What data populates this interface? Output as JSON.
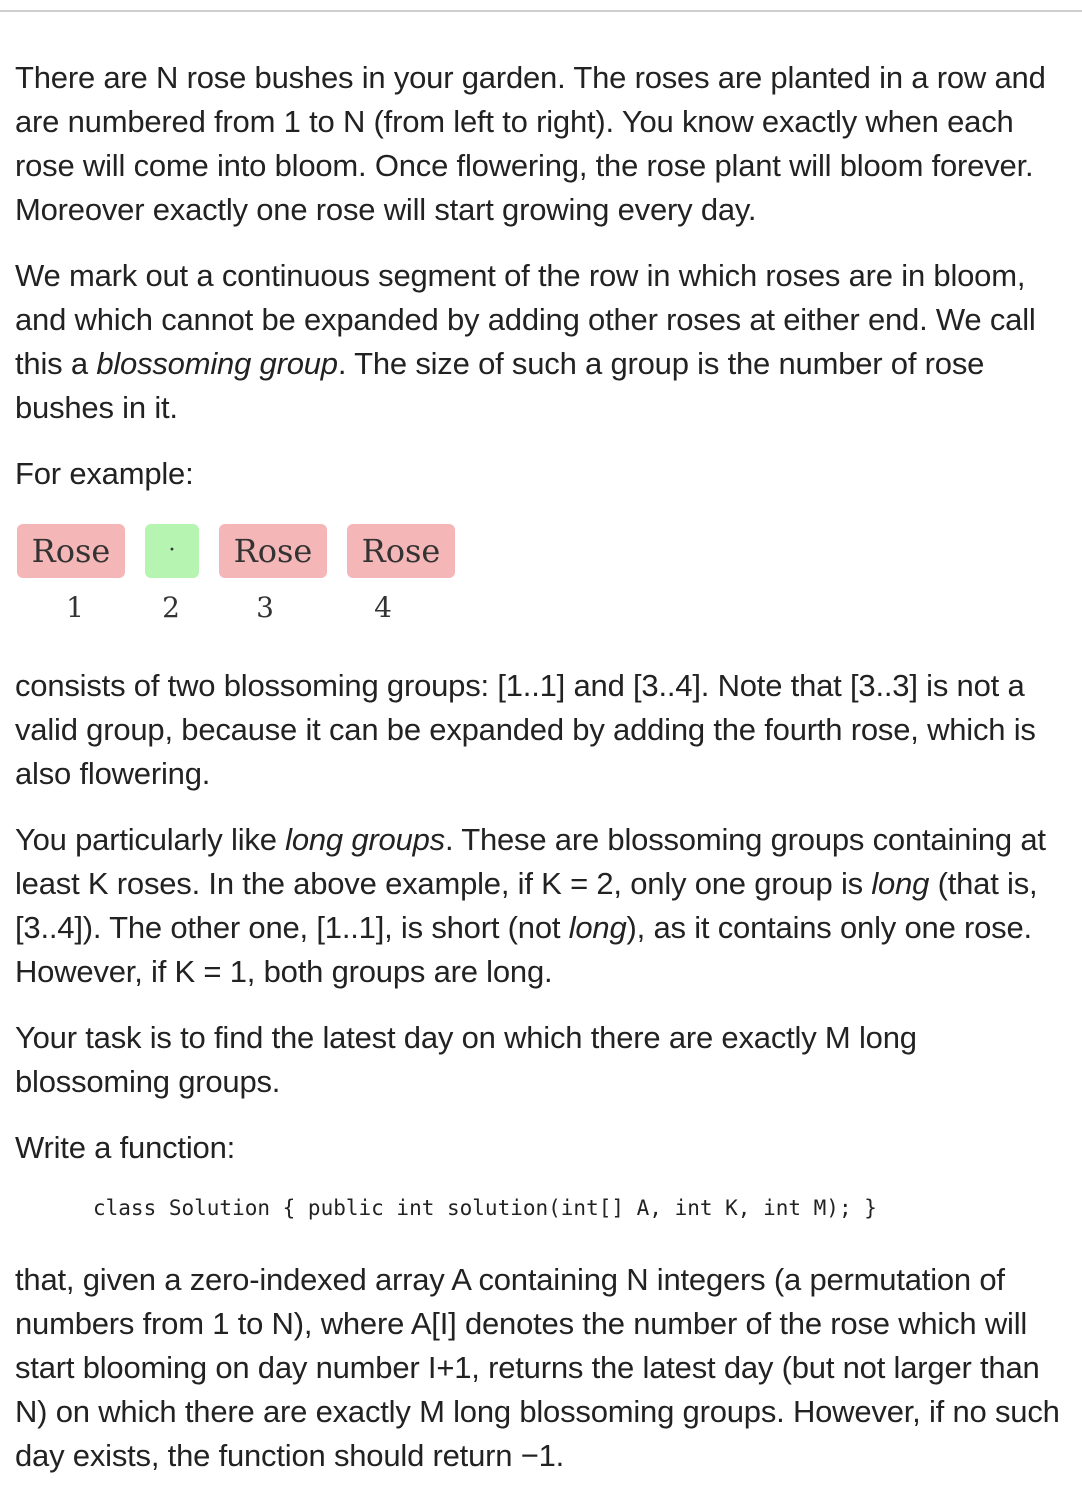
{
  "paragraphs": {
    "p1": "There are N rose bushes in your garden. The roses are planted in a row and are numbered from 1 to N (from left to right). You know exactly when each rose will come into bloom. Once flowering, the rose plant will bloom forever. Moreover exactly one rose will start growing every day.",
    "p2_a": "We mark out a continuous segment of the row in which roses are in bloom, and which cannot be expanded by adding other roses at either end. We call this a ",
    "p2_em": "blossoming group",
    "p2_b": ". The size of such a group is the number of rose bushes in it.",
    "p3": "For example:",
    "p4": "consists of two blossoming groups: [1..1] and [3..4]. Note that [3..3] is not a valid group, because it can be expanded by adding the fourth rose, which is also flowering.",
    "p5_a": "You particularly like ",
    "p5_em1": "long groups",
    "p5_b": ". These are blossoming groups containing at least K roses. In the above example, if K = 2, only one group is ",
    "p5_em2": "long",
    "p5_c": " (that is, [3..4]). The other one, [1..1], is short (not ",
    "p5_em3": "long",
    "p5_d": "), as it contains only one rose. However, if K = 1, both groups are long.",
    "p6": "Your task is to find the latest day on which there are exactly M long blossoming groups.",
    "p7": "Write a function:",
    "p8": "that, given a zero-indexed array A containing N integers (a permutation of numbers from 1 to N), where A[I] denotes the number of the rose which will start blooming on day number I+1, returns the latest day (but not larger than N) on which there are exactly M long blossoming groups. However, if no such day exists, the function should return −1."
  },
  "example": {
    "boxes": [
      {
        "label": "Rose",
        "number": "1"
      },
      {
        "label": "·",
        "number": "2"
      },
      {
        "label": "Rose",
        "number": "3"
      },
      {
        "label": "Rose",
        "number": "4"
      }
    ],
    "colors": {
      "bloom": "#f4b6b6",
      "empty": "#b6f4b2"
    }
  },
  "code": {
    "signature": "class Solution { public int solution(int[] A, int K, int M); }"
  }
}
